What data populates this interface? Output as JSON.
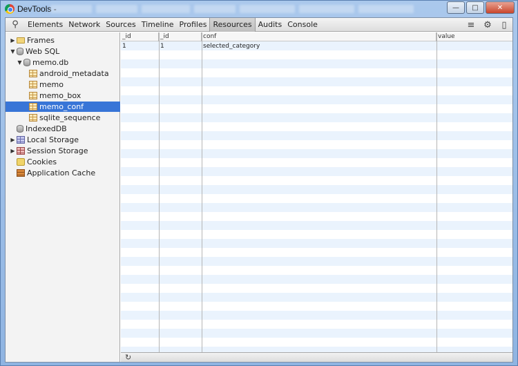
{
  "window": {
    "title": "DevTools -"
  },
  "toolbar": {
    "tabs": [
      {
        "label": "Elements"
      },
      {
        "label": "Network"
      },
      {
        "label": "Sources"
      },
      {
        "label": "Timeline"
      },
      {
        "label": "Profiles"
      },
      {
        "label": "Resources",
        "active": true
      },
      {
        "label": "Audits"
      },
      {
        "label": "Console"
      }
    ]
  },
  "sidebar": {
    "items": [
      {
        "label": "Frames",
        "icon": "folder-icon"
      },
      {
        "label": "Web SQL",
        "icon": "database-icon"
      },
      {
        "label": "memo.db",
        "icon": "database-icon"
      },
      {
        "label": "android_metadata",
        "icon": "table-icon"
      },
      {
        "label": "memo",
        "icon": "table-icon"
      },
      {
        "label": "memo_box",
        "icon": "table-icon"
      },
      {
        "label": "memo_conf",
        "icon": "table-icon",
        "selected": true
      },
      {
        "label": "sqlite_sequence",
        "icon": "table-icon"
      },
      {
        "label": "IndexedDB",
        "icon": "database-icon"
      },
      {
        "label": "Local Storage",
        "icon": "storage-icon"
      },
      {
        "label": "Session Storage",
        "icon": "storage-icon"
      },
      {
        "label": "Cookies",
        "icon": "cookie-icon"
      },
      {
        "label": "Application Cache",
        "icon": "cache-icon"
      }
    ]
  },
  "table": {
    "columns": [
      "_id",
      "_id",
      "conf",
      "value"
    ],
    "rows": [
      [
        "1",
        "1",
        "selected_category",
        ""
      ]
    ]
  },
  "colors": {
    "selection": "#3875d7",
    "row_stripe": "#eaf3fd"
  }
}
